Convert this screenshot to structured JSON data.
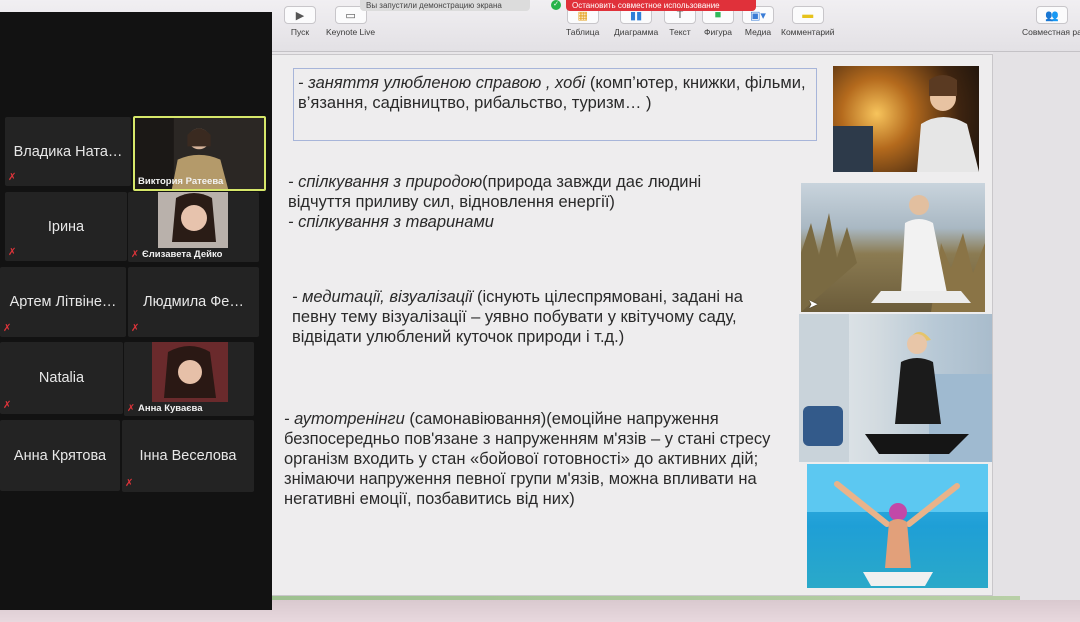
{
  "share": {
    "demo_label": "Вы запустили демонстрацию экрана",
    "stop_label": "Остановить совместное использование"
  },
  "toolbar": {
    "play_label": "Пуск",
    "keynote_live_label": "Keynote Live",
    "table_label": "Таблица",
    "chart_label": "Диаграмма",
    "text_label": "Текст",
    "shape_label": "Фигура",
    "media_label": "Медиа",
    "comment_label": "Комментарий",
    "collab_label": "Совместная ра"
  },
  "slide": {
    "block1": {
      "italic": "- заняття улюбленою справою , хобі",
      "rest": " (комп’ютер, книжки, фільми, в’язання, садівництво, рибальство, туризм… )"
    },
    "block2": {
      "italic1": "- спілкування з природою",
      "rest1": "(природа завжди дає людині відчуття приливу сил, відновлення енергії)",
      "italic2": "- спілкування з тваринами"
    },
    "block3": {
      "italic": "- медитації, візуалізації",
      "rest": " (існують цілеспрямовані, задані на певну тему візуалізації – уявно побувати у квітучому саду, відвідати улюблений куточок природи і т.д.)"
    },
    "block4": {
      "italic": "- аутотренінги",
      "rest": " (самонавіювання)(емоційне напруження безпосередньо пов'язане з напруженням м'язів – у стані стресу організм входить у стан «бойової готовності» до активних дій; знімаючи напруження певної групи м'язів, можна впливати на негативні емоції, позбавитись від них)"
    }
  },
  "participants": [
    {
      "name": "Владика Ната…",
      "video": false
    },
    {
      "name": "Виктория Ратеева",
      "video": true,
      "active": true
    },
    {
      "name": "Ірина",
      "video": false
    },
    {
      "name": "Єлизавета Дейко",
      "video": true
    },
    {
      "name": "Артем Літвіне…",
      "video": false
    },
    {
      "name": "Людмила Фе…",
      "video": false
    },
    {
      "name": "Natalia",
      "video": false
    },
    {
      "name": "Анна Куваєва",
      "video": true
    },
    {
      "name": "Анна Крятова",
      "video": false
    },
    {
      "name": "Інна Веселова",
      "video": false
    }
  ],
  "colors": {
    "active_border": "#d6e76a",
    "mute_red": "#e0343a",
    "stop_red": "#e0313a"
  }
}
